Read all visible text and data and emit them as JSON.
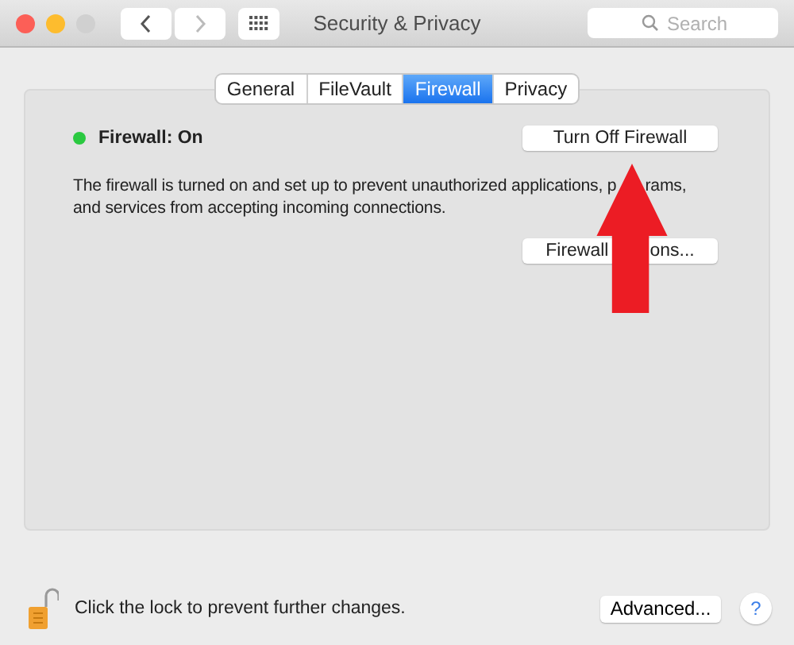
{
  "window": {
    "title": "Security & Privacy",
    "search": {
      "placeholder": "Search"
    }
  },
  "tabs": [
    {
      "label": "General",
      "selected": false
    },
    {
      "label": "FileVault",
      "selected": false
    },
    {
      "label": "Firewall",
      "selected": true
    },
    {
      "label": "Privacy",
      "selected": false
    }
  ],
  "firewall": {
    "status": "Firewall: On",
    "on": true,
    "color": "#2ac940",
    "toggle_button": "Turn Off Firewall",
    "description_line_1_start": "The firewall is turned on and set up to prevent unauthorized applications, p",
    "description_line_1_end": "rams,",
    "description_line_2": "and services from accepting incoming connections.",
    "options_button_start": "Firewall",
    "options_button_end": "ons..."
  },
  "footer": {
    "lock_text": "Click the lock to prevent further changes.",
    "advanced_button": "Advanced...",
    "help": "?"
  }
}
